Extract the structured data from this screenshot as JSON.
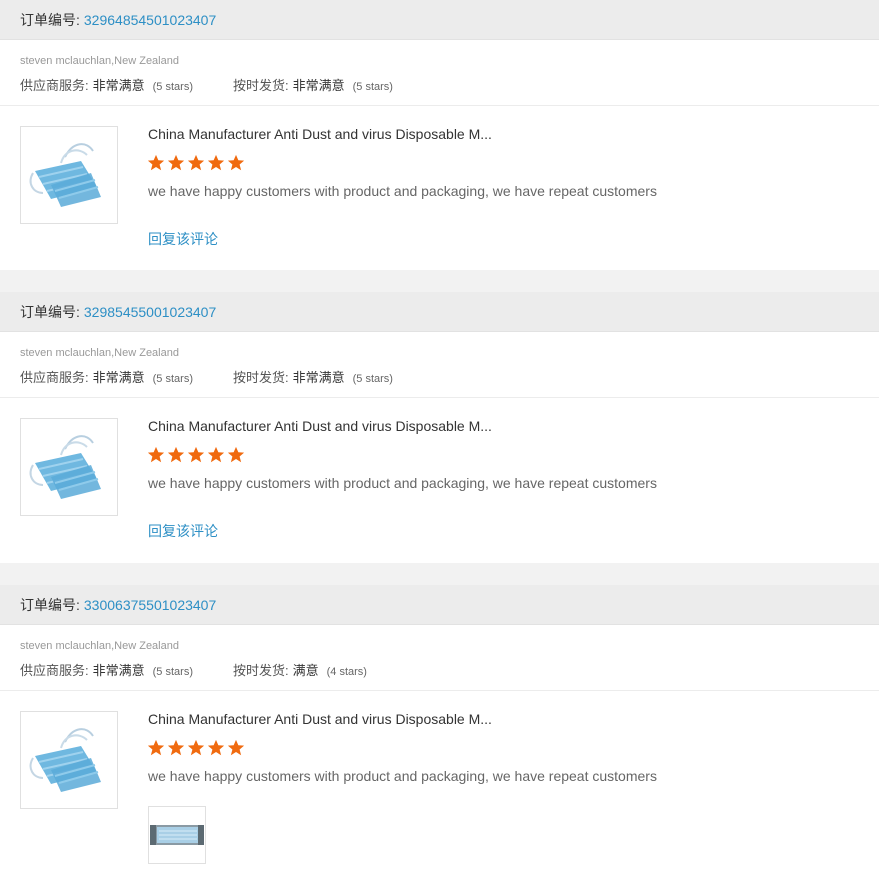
{
  "order_label": "订单编号:",
  "reviews": [
    {
      "order_number": "32964854501023407",
      "buyer": "steven mclauchlan,New Zealand",
      "supplier_label": "供应商服务:",
      "supplier_value": "非常满意",
      "supplier_stars": "(5 stars)",
      "shipping_label": "按时发货:",
      "shipping_value": "非常满意",
      "shipping_stars": "(5 stars)",
      "product_title": "China Manufacturer Anti Dust and virus Disposable M...",
      "rating": 5,
      "comment": "we have happy customers with product and packaging, we have repeat customers",
      "reply_label": "回复该评论"
    },
    {
      "order_number": "32985455001023407",
      "buyer": "steven mclauchlan,New Zealand",
      "supplier_label": "供应商服务:",
      "supplier_value": "非常满意",
      "supplier_stars": "(5 stars)",
      "shipping_label": "按时发货:",
      "shipping_value": "非常满意",
      "shipping_stars": "(5 stars)",
      "product_title": "China Manufacturer Anti Dust and virus Disposable M...",
      "rating": 5,
      "comment": "we have happy customers with product and packaging, we have repeat customers",
      "reply_label": "回复该评论"
    },
    {
      "order_number": "33006375501023407",
      "buyer": "steven mclauchlan,New Zealand",
      "supplier_label": "供应商服务:",
      "supplier_value": "非常满意",
      "supplier_stars": "(5 stars)",
      "shipping_label": "按时发货:",
      "shipping_value": "满意",
      "shipping_stars": "(4 stars)",
      "product_title": "China Manufacturer Anti Dust and virus Disposable M...",
      "rating": 5,
      "comment": "we have happy customers with product and packaging, we have repeat customers"
    }
  ],
  "colors": {
    "link": "#2d8fc5",
    "star": "#f06a0f"
  },
  "icons": {
    "product_image": "face-mask-image",
    "star": "star-icon",
    "attachment": "mask-photo-thumbnail"
  }
}
